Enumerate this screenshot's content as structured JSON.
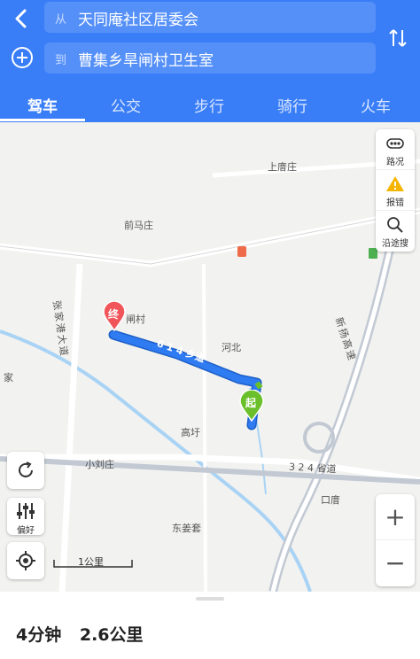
{
  "search": {
    "from_prefix": "从",
    "from_value": "天同庵社区居委会",
    "to_prefix": "到",
    "to_value": "曹集乡旱闸村卫生室"
  },
  "tabs": [
    "驾车",
    "公交",
    "步行",
    "骑行",
    "火车"
  ],
  "active_tab": "驾车",
  "map_controls": {
    "traffic": "路况",
    "report": "报错",
    "search_along": "沿途搜",
    "preference": "偏好",
    "zoom_in": "+",
    "zoom_out": "−",
    "scale": "1公里"
  },
  "places": {
    "shangtang": "上庴庄",
    "qianma": "前马庄",
    "zhajia": "闸村",
    "hebei": "河北",
    "gaoxu": "高圩",
    "xiaoliu": "小刘庄",
    "kouzhuang": "口庴",
    "dongjiang": "东姜套",
    "jia": "家",
    "road_zhangjia": "张家港大道",
    "road_xinyang": "新扬高速",
    "road_324": "3 2 4 省道",
    "road_614": "6 1 4 乡道"
  },
  "markers": {
    "end": "终",
    "start": "起"
  },
  "summary": {
    "duration": "4分钟",
    "distance": "2.6公里"
  },
  "colors": {
    "header": "#3a7ef7",
    "route": "#2f7bf2",
    "start": "#6abf2a",
    "end": "#f0555a"
  }
}
